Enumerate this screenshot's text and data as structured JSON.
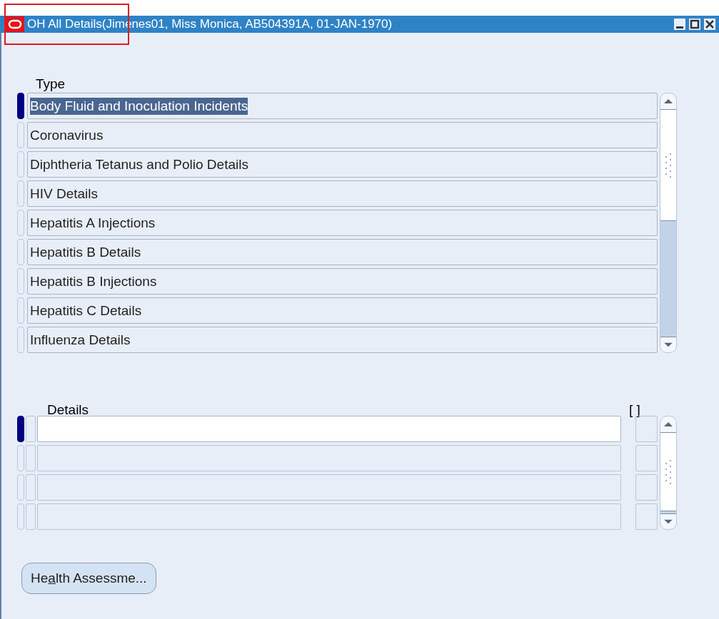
{
  "window": {
    "title": "OH All Details(Jimenes01, Miss Monica, AB504391A, 01-JAN-1970)"
  },
  "type_block": {
    "heading": "Type",
    "rows": [
      {
        "value": "Body Fluid and Inoculation Incidents",
        "selected": true
      },
      {
        "value": "Coronavirus",
        "selected": false
      },
      {
        "value": "Diphtheria Tetanus and Polio Details",
        "selected": false
      },
      {
        "value": "HIV Details",
        "selected": false
      },
      {
        "value": "Hepatitis A Injections",
        "selected": false
      },
      {
        "value": "Hepatitis B Details",
        "selected": false
      },
      {
        "value": "Hepatitis B Injections",
        "selected": false
      },
      {
        "value": "Hepatitis C Details",
        "selected": false
      },
      {
        "value": "Influenza Details",
        "selected": false
      }
    ]
  },
  "details_block": {
    "heading": "Details",
    "flex_heading": "[ ]",
    "rows": [
      {
        "selected": true
      },
      {
        "selected": false
      },
      {
        "selected": false
      },
      {
        "selected": false
      }
    ]
  },
  "buttons": [
    {
      "label_parts": [
        "He",
        "a",
        "lth Assessme..."
      ]
    }
  ]
}
